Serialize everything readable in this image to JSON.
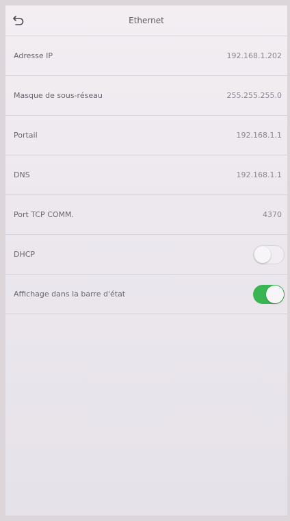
{
  "header": {
    "title": "Ethernet",
    "back_icon": "back-arrow-icon"
  },
  "settings": [
    {
      "label": "Adresse IP",
      "value": "192.168.1.202"
    },
    {
      "label": "Masque de sous-réseau",
      "value": "255.255.255.0"
    },
    {
      "label": "Portail",
      "value": "192.168.1.1"
    },
    {
      "label": "DNS",
      "value": "192.168.1.1"
    },
    {
      "label": "Port TCP COMM.",
      "value": "4370"
    },
    {
      "label": "DHCP",
      "toggle": false
    },
    {
      "label": "Affichage dans la barre d'état",
      "toggle": true
    }
  ],
  "colors": {
    "toggle_on": "#39b552",
    "background": "#ece8ee"
  }
}
